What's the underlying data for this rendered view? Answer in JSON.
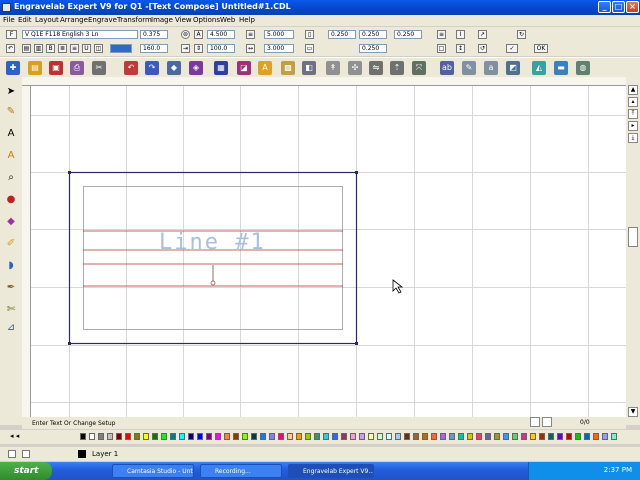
{
  "window": {
    "title": "Engravelab Expert V9 for Q1 -[Text Compose] Untitled#1.CDL",
    "min_label": "_",
    "max_label": "□",
    "close_label": "×"
  },
  "menu": [
    "File",
    "Edit",
    "Layout",
    "Arrange",
    "Engrave",
    "Transform",
    "Image",
    "View",
    "Options",
    "Web",
    "Help"
  ],
  "toolbar": {
    "font_style_value": "F",
    "font_name_value": "V  Q1E F118 English 3 Ln",
    "height_value": "0.375",
    "width_value": "160.0",
    "char_spacing_value": "4.500",
    "line_spacing_value": "100.0",
    "val_a": "5.000",
    "val_b": "3.000",
    "margin_left_value": "0.250",
    "margin_top_value": "0.250",
    "margin_bottom_value": "0.250",
    "margin_right_value": "0.250",
    "ok_label": "OK"
  },
  "canvas": {
    "text_line": "Line #1",
    "accent_line": "#b03030",
    "text_color": "#a8c0e0",
    "plate_border": "#2a2a6a"
  },
  "status": {
    "text": "Enter Text Or Change Setup",
    "page_value": "0/0"
  },
  "palette": [
    "#000000",
    "#ffffff",
    "#808080",
    "#c0c0c0",
    "#800000",
    "#ff0000",
    "#808000",
    "#ffff00",
    "#008000",
    "#00ff00",
    "#008080",
    "#00ffff",
    "#000080",
    "#0000ff",
    "#800080",
    "#ff00ff",
    "#ff8040",
    "#804000",
    "#80ff00",
    "#004040",
    "#0080ff",
    "#8080ff",
    "#ff0080",
    "#ffcc99",
    "#ff9900",
    "#99cc00",
    "#339966",
    "#33cccc",
    "#3366ff",
    "#993366",
    "#ff99cc",
    "#cc99ff",
    "#ffff99",
    "#ccffcc",
    "#ccffff",
    "#99ccff",
    "#663300",
    "#996633",
    "#cc6600",
    "#ff6633",
    "#9966ff",
    "#6699cc",
    "#00cc99",
    "#cccc00",
    "#ff3366",
    "#666699",
    "#999933",
    "#3399ff",
    "#66cc66",
    "#cc3399",
    "#ffcc00",
    "#993300",
    "#006666",
    "#6600cc",
    "#cc0000",
    "#00cc00",
    "#0066cc",
    "#ff6600",
    "#9999ff",
    "#66ffcc"
  ],
  "layer": {
    "label": "Layer 1"
  },
  "taskbar": {
    "start_label": "start",
    "tasks": [
      "Camtasia Studio - Unt...",
      "Recording...",
      "Engravelab Expert V9..."
    ],
    "clock": "2:37 PM"
  }
}
